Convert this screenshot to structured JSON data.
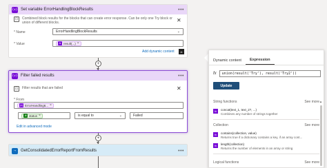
{
  "set_variable": {
    "title": "Set variable ErrorHandlingBlockResults",
    "icon": "{x}",
    "info": "Combined block results for the blocks that can create error response. Can be only one Try block or union of different blocks.",
    "name_label": "* Name",
    "name_value": "ErrorHandlingBlockResults",
    "value_label": "* Value",
    "value_token": "result(...)",
    "add_dynamic_link": "Add dynamic content",
    "fx_label": "fx"
  },
  "filter": {
    "title": "Filter failed results",
    "icon": "{v}",
    "info": "Filter results that are failed",
    "from_label": "* From",
    "from_token": "ErrorHandling6...",
    "condition_token": "status",
    "operator": "is equal to",
    "value": "Failed",
    "advanced_link": "Edit in advanced mode"
  },
  "next_action": {
    "title": "GetConsolidatedErrorReportFromResults"
  },
  "expression_panel": {
    "tabs": [
      "Dynamic content",
      "Expression"
    ],
    "active_tab": "Expression",
    "expression": "union(result('Try'), result('Try2'))",
    "update_label": "Update",
    "sections": [
      {
        "title": "String functions",
        "see_more": "See more",
        "functions": [
          {
            "name": "concat(text_1, text_2?, ...)",
            "desc": "Combines any number of strings together"
          }
        ]
      },
      {
        "title": "Collection",
        "see_more": "See more",
        "functions": [
          {
            "name": "contains(collection, value)",
            "desc": "Returns true if a dictionary contains a key, if an array cont..."
          },
          {
            "name": "length(collection)",
            "desc": "Returns the number of elements in an array or string"
          }
        ]
      },
      {
        "title": "Logical functions",
        "see_more": "See more",
        "functions": []
      }
    ]
  },
  "colors": {
    "accent_purple": "#770bd6",
    "header_purple": "#e9d7f8",
    "header_blue": "#d6ebf7",
    "update_button": "#1f4e79"
  }
}
